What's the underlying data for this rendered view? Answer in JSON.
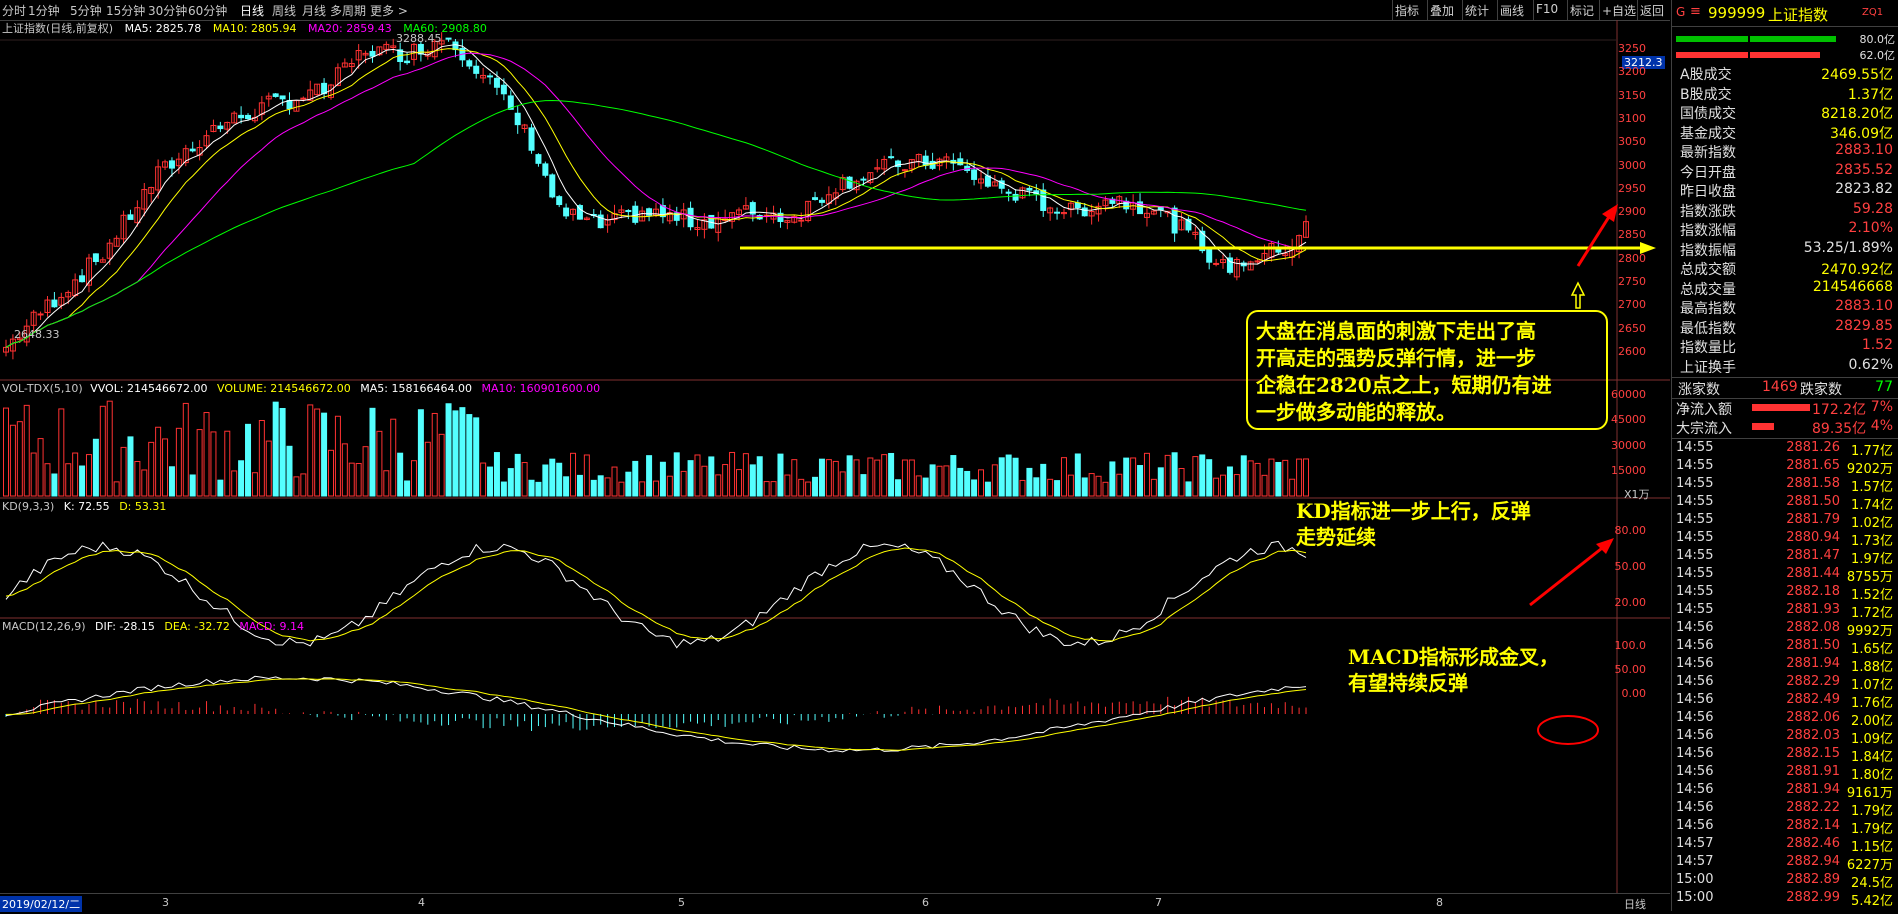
{
  "toolbar": {
    "timeframes": [
      "分时",
      "1分钟",
      "5分钟",
      "15分钟",
      "30分钟",
      "60分钟",
      "日线",
      "周线",
      "月线",
      "多周期",
      "更多 >"
    ],
    "active_timeframe": "日线",
    "right_tools": [
      "指标",
      "叠加",
      "统计",
      "画线",
      "F10",
      "标记",
      "+自选",
      "返回"
    ]
  },
  "chart_header": {
    "title": "上证指数(日线,前复权)",
    "ma5": "MA5: 2825.78",
    "ma10": "MA10: 2805.94",
    "ma20": "MA20: 2859.43",
    "ma60": "MA60: 2908.80"
  },
  "main_yaxis": [
    "3250",
    "3200",
    "3150",
    "3100",
    "3050",
    "3000",
    "2950",
    "2900",
    "2850",
    "2800",
    "2750",
    "2700",
    "2650",
    "2600"
  ],
  "current_price_tag": "3212.3",
  "high_label": "3288.45",
  "low_label": "2648.33",
  "vol_header": {
    "name": "VOL-TDX(5,10)",
    "vvol": "VVOL: 214546672.00",
    "volume": "VOLUME: 214546672.00",
    "ma5": "MA5: 158166464.00",
    "ma10": "MA10: 160901600.00"
  },
  "vol_yaxis": [
    "60000",
    "45000",
    "30000",
    "15000"
  ],
  "vol_unit": "X1万",
  "kd_header": {
    "name": "KD(9,3,3)",
    "k": "K: 72.55",
    "d": "D: 53.31"
  },
  "kd_yaxis": [
    "80.00",
    "50.00",
    "20.00"
  ],
  "macd_header": {
    "name": "MACD(12,26,9)",
    "dif": "DIF: -28.15",
    "dea": "DEA: -32.72",
    "macd": "MACD: 9.14"
  },
  "macd_yaxis": [
    "100.0",
    "50.00",
    "0.00"
  ],
  "xaxis": {
    "start": "2019/02/12/二",
    "months": [
      "3",
      "4",
      "5",
      "6",
      "7",
      "8"
    ],
    "period": "日线"
  },
  "annotations": {
    "main": [
      "大盘在消息面的刺激下走出了高",
      "开高走的强势反弹行情，进一步",
      "企稳在2820点之上，短期仍有进",
      "一步做多动能的释放。"
    ],
    "kd": [
      "KD指标进一步上行，反弹",
      "走势延续"
    ],
    "macd": [
      "MACD指标形成金叉，",
      "有望持续反弹"
    ]
  },
  "panel": {
    "code": "999999",
    "name": "上证指数",
    "tag": "ZQ1",
    "bar_values": [
      "80.0亿",
      "62.0亿"
    ],
    "stats": [
      {
        "label": "A股成交",
        "value": "2469.55亿",
        "color": "#ffff00"
      },
      {
        "label": "B股成交",
        "value": "1.37亿",
        "color": "#ffff00"
      },
      {
        "label": "国债成交",
        "value": "8218.20亿",
        "color": "#ffff00"
      },
      {
        "label": "基金成交",
        "value": "346.09亿",
        "color": "#ffff00"
      },
      {
        "label": "最新指数",
        "value": "2883.10",
        "color": "#ff4040"
      },
      {
        "label": "今日开盘",
        "value": "2835.52",
        "color": "#ff4040"
      },
      {
        "label": "昨日收盘",
        "value": "2823.82",
        "color": "#e0e0e0"
      },
      {
        "label": "指数涨跌",
        "value": "59.28",
        "color": "#ff4040"
      },
      {
        "label": "指数涨幅",
        "value": "2.10%",
        "color": "#ff4040"
      },
      {
        "label": "指数振幅",
        "value": "53.25/1.89%",
        "color": "#e0e0e0"
      },
      {
        "label": "总成交额",
        "value": "2470.92亿",
        "color": "#ffff00"
      },
      {
        "label": "总成交量",
        "value": "214546668",
        "color": "#ffff00"
      },
      {
        "label": "最高指数",
        "value": "2883.10",
        "color": "#ff4040"
      },
      {
        "label": "最低指数",
        "value": "2829.85",
        "color": "#ff4040"
      },
      {
        "label": "指数量比",
        "value": "1.52",
        "color": "#ff4040"
      },
      {
        "label": "上证换手",
        "value": "0.62%",
        "color": "#e0e0e0"
      }
    ],
    "updown": {
      "up_label": "涨家数",
      "up": "1469",
      "down_label": "跌家数",
      "down": "77"
    },
    "flows": [
      {
        "label": "净流入额",
        "value": "172.2亿",
        "pct": "7%"
      },
      {
        "label": "大宗流入",
        "value": "89.35亿",
        "pct": "4%"
      }
    ],
    "ticks": [
      [
        "14:55",
        "2881.26",
        "1.77亿"
      ],
      [
        "14:55",
        "2881.65",
        "9202万"
      ],
      [
        "14:55",
        "2881.58",
        "1.57亿"
      ],
      [
        "14:55",
        "2881.50",
        "1.74亿"
      ],
      [
        "14:55",
        "2881.79",
        "1.02亿"
      ],
      [
        "14:55",
        "2880.94",
        "1.73亿"
      ],
      [
        "14:55",
        "2881.47",
        "1.97亿"
      ],
      [
        "14:55",
        "2881.44",
        "8755万"
      ],
      [
        "14:55",
        "2882.18",
        "1.52亿"
      ],
      [
        "14:55",
        "2881.93",
        "1.72亿"
      ],
      [
        "14:56",
        "2882.08",
        "9992万"
      ],
      [
        "14:56",
        "2881.50",
        "1.65亿"
      ],
      [
        "14:56",
        "2881.94",
        "1.88亿"
      ],
      [
        "14:56",
        "2882.29",
        "1.07亿"
      ],
      [
        "14:56",
        "2882.49",
        "1.76亿"
      ],
      [
        "14:56",
        "2882.06",
        "2.00亿"
      ],
      [
        "14:56",
        "2882.03",
        "1.09亿"
      ],
      [
        "14:56",
        "2882.15",
        "1.84亿"
      ],
      [
        "14:56",
        "2881.91",
        "1.80亿"
      ],
      [
        "14:56",
        "2881.94",
        "9161万"
      ],
      [
        "14:56",
        "2882.22",
        "1.79亿"
      ],
      [
        "14:56",
        "2882.14",
        "1.79亿"
      ],
      [
        "14:57",
        "2882.46",
        "1.15亿"
      ],
      [
        "14:57",
        "2882.94",
        "6227万"
      ],
      [
        "15:00",
        "2882.89",
        "24.5亿"
      ],
      [
        "15:00",
        "2882.99",
        "5.42亿"
      ]
    ]
  },
  "colors": {
    "up": "#ff3232",
    "down": "#54ffff",
    "ma5": "#ffffff",
    "ma10": "#ffff00",
    "ma20": "#ff00ff",
    "ma60": "#00ff00",
    "annotation": "#ffff00",
    "arrow": "#ff0000"
  }
}
